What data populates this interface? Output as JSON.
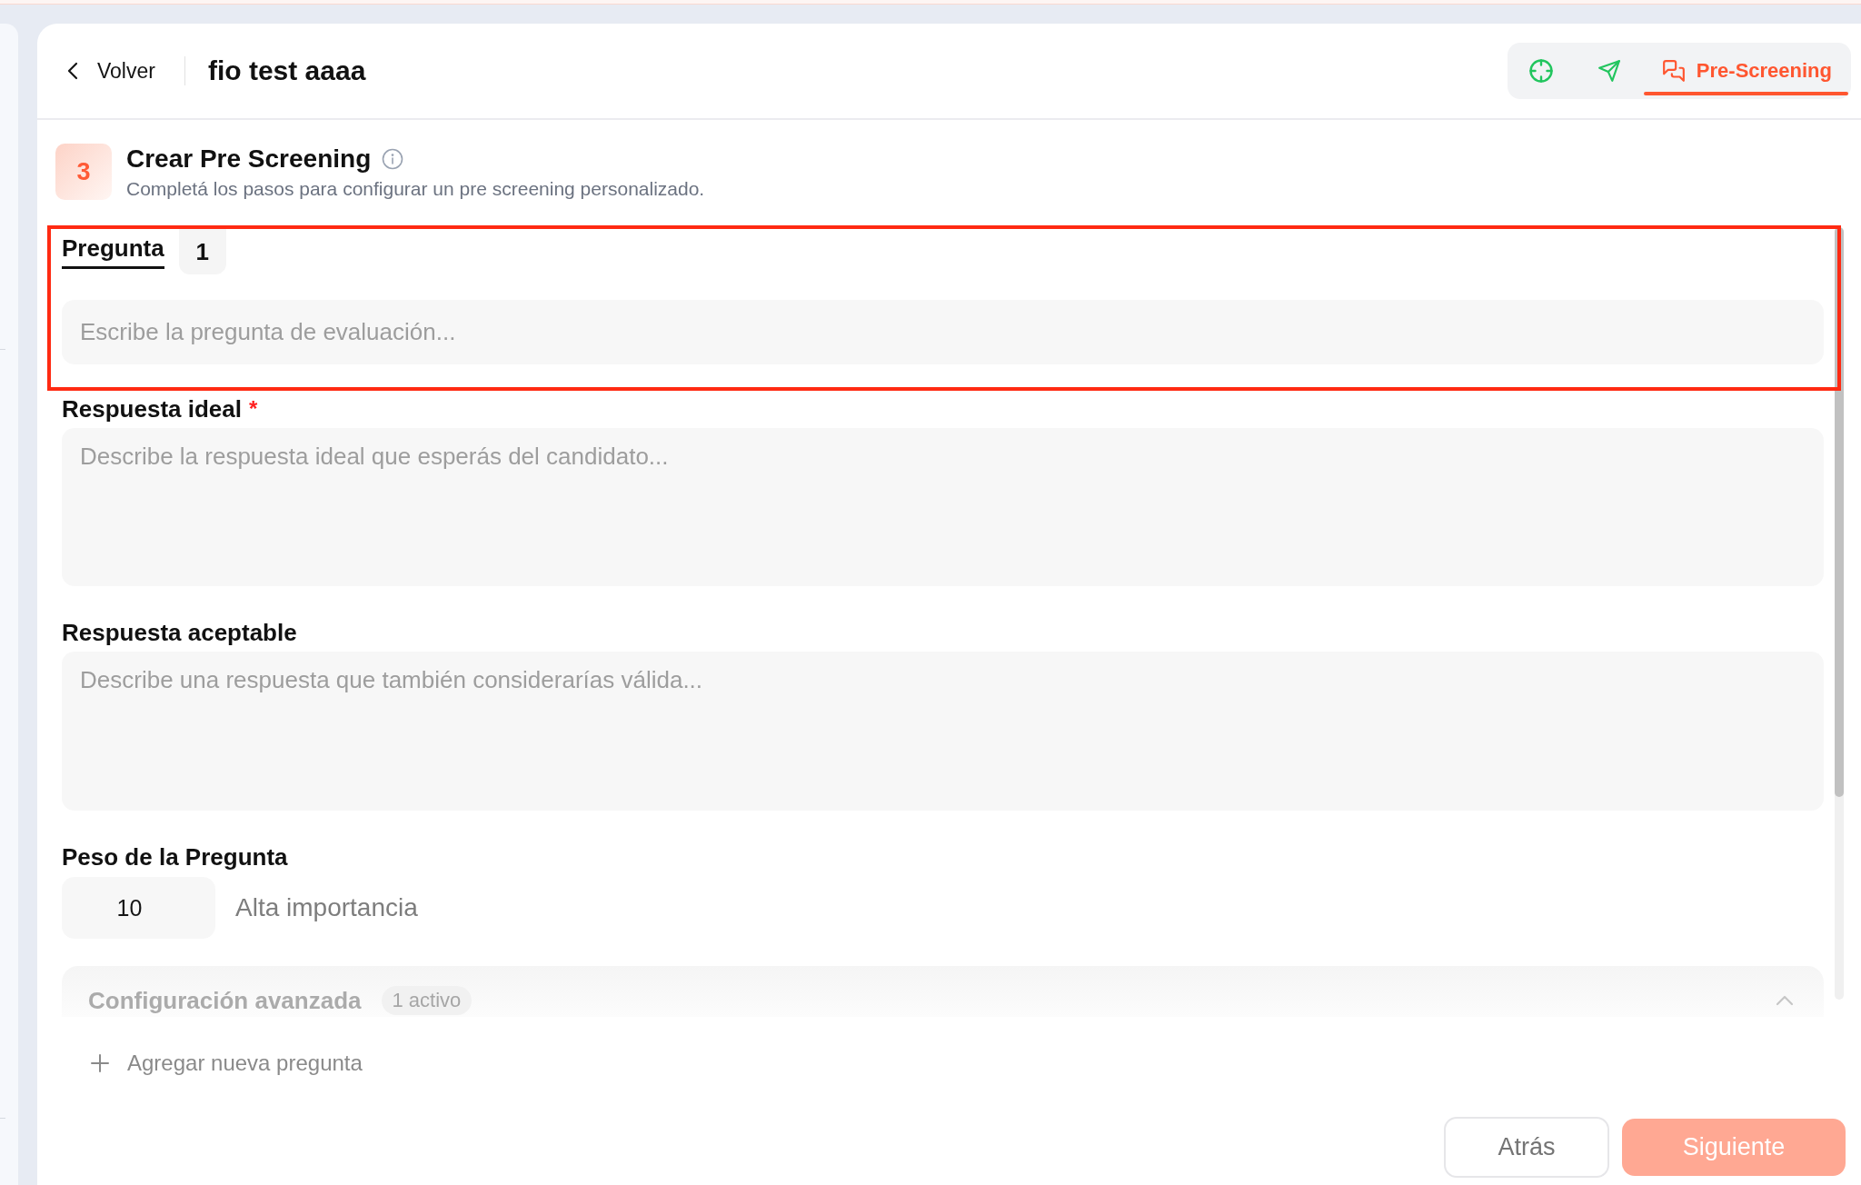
{
  "header": {
    "back_label": "Volver",
    "title": "fio test aaaa",
    "tabs": [
      {
        "selected": false
      },
      {
        "selected": false
      },
      {
        "label": "Pre-Screening",
        "selected": true
      }
    ]
  },
  "section": {
    "step": "3",
    "title": "Crear Pre Screening",
    "subtitle": "Completá los pasos para configurar un pre screening personalizado."
  },
  "question_tabs": [
    {
      "label": "Pregunta",
      "selected": true
    },
    {
      "label": "1",
      "selected": false
    }
  ],
  "question_field": {
    "placeholder": "Escribe la pregunta de evaluación..."
  },
  "fields": [
    {
      "label": "Respuesta ideal",
      "required_mark": "*",
      "placeholder": "Describe la respuesta ideal que esperás del candidato..."
    },
    {
      "label": "Respuesta aceptable",
      "placeholder": "Describe una respuesta que también considerarías válida..."
    }
  ],
  "weight": {
    "label": "Peso de la Pregunta",
    "value": "10",
    "caption": "Alta importancia"
  },
  "advanced": {
    "title": "Configuración avanzada",
    "badge": "1 activo",
    "expanded": true
  },
  "add_question": "Agregar nueva pregunta",
  "buttons": [
    {
      "label": "Atrás",
      "kind": "secondary",
      "disabled": false
    },
    {
      "label": "Siguiente",
      "kind": "primary",
      "disabled": true
    }
  ]
}
